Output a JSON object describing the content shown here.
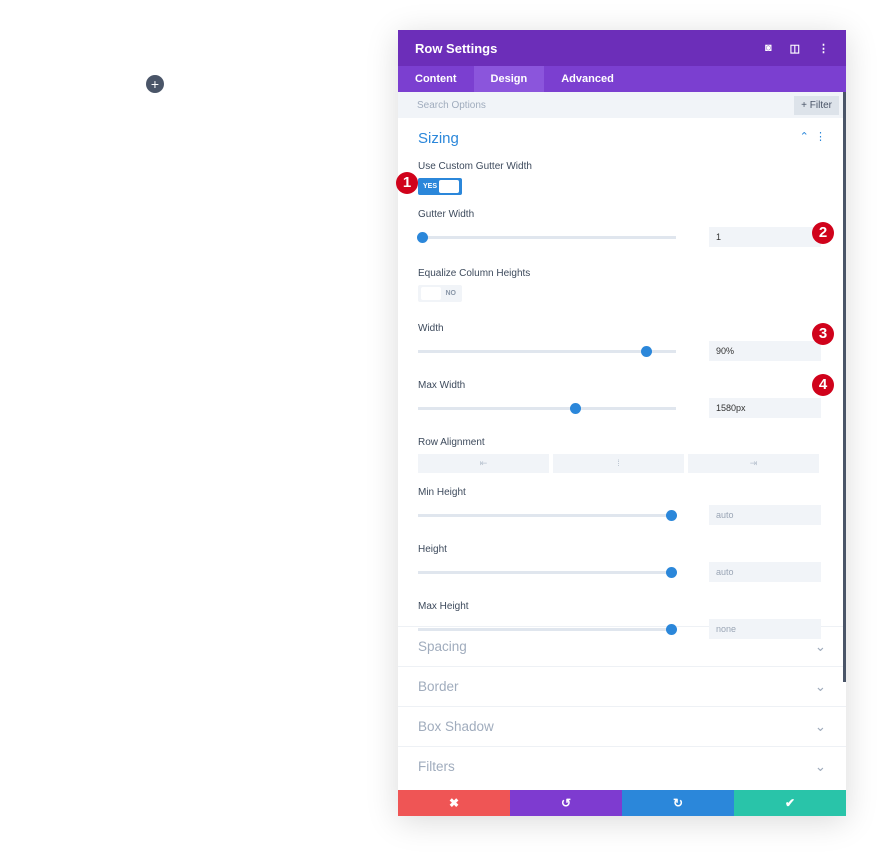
{
  "page": {
    "add_icon": "plus-icon"
  },
  "panel": {
    "title": "Row Settings",
    "header_icons": [
      "focus-icon",
      "split-view-icon",
      "more-icon"
    ],
    "tabs": [
      {
        "label": "Content"
      },
      {
        "label": "Design",
        "active": true
      },
      {
        "label": "Advanced"
      }
    ],
    "search_placeholder": "Search Options",
    "filter_label": "+ Filter"
  },
  "sizing": {
    "title": "Sizing",
    "custom_gutter": {
      "label": "Use Custom Gutter Width",
      "value": "YES",
      "badge": "1"
    },
    "gutter_width": {
      "label": "Gutter Width",
      "value": "1",
      "level": 0,
      "badge": "2"
    },
    "equalize": {
      "label": "Equalize Column Heights",
      "value": "NO"
    },
    "width": {
      "label": "Width",
      "value": "90%",
      "level": 89,
      "badge": "3"
    },
    "max_width": {
      "label": "Max Width",
      "value": "1580px",
      "level": 61,
      "badge": "4"
    },
    "row_alignment": {
      "label": "Row Alignment",
      "options": [
        "⇤",
        "⁞",
        "⇥"
      ]
    },
    "min_height": {
      "label": "Min Height",
      "value": "auto",
      "level": 100
    },
    "height": {
      "label": "Height",
      "value": "auto",
      "level": 100
    },
    "max_height": {
      "label": "Max Height",
      "value": "none",
      "level": 100
    }
  },
  "sections": [
    "Spacing",
    "Border",
    "Box Shadow",
    "Filters"
  ],
  "footer": {
    "cancel": "✖",
    "undo": "↺",
    "redo": "↻",
    "save": "✔",
    "colors": [
      "#ef5555",
      "#7e3bd0",
      "#2b87da",
      "#29c4a9"
    ]
  }
}
